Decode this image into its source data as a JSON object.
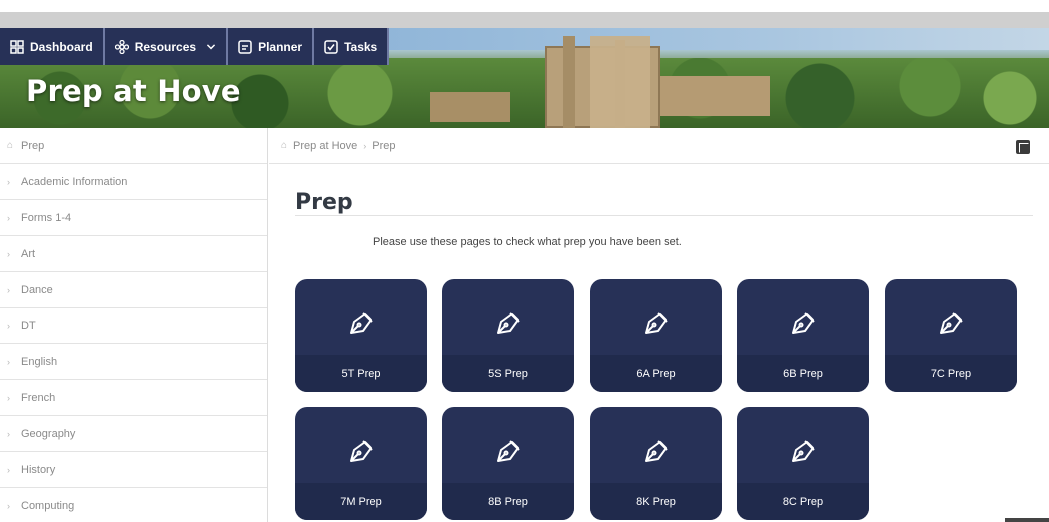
{
  "nav": {
    "items": [
      {
        "label": "Dashboard",
        "icon": "grid-icon"
      },
      {
        "label": "Resources",
        "icon": "cog-flower-icon"
      },
      {
        "label": "Planner",
        "icon": "planner-icon"
      },
      {
        "label": "Tasks",
        "icon": "checkbox-icon"
      }
    ]
  },
  "site": {
    "title": "Prep at Hove"
  },
  "sidebar": {
    "items": [
      {
        "label": "Prep"
      },
      {
        "label": "Academic Information"
      },
      {
        "label": "Forms 1-4"
      },
      {
        "label": "Art"
      },
      {
        "label": "Dance"
      },
      {
        "label": "DT"
      },
      {
        "label": "English"
      },
      {
        "label": "French"
      },
      {
        "label": "Geography"
      },
      {
        "label": "History"
      },
      {
        "label": "Computing"
      }
    ]
  },
  "breadcrumb": {
    "items": [
      "Prep at Hove",
      "Prep"
    ]
  },
  "page": {
    "title": "Prep",
    "intro": "Please use these pages to check what prep you have been set."
  },
  "tiles": [
    {
      "label": "5T Prep"
    },
    {
      "label": "5S Prep"
    },
    {
      "label": "6A Prep"
    },
    {
      "label": "6B Prep"
    },
    {
      "label": "7C Prep"
    },
    {
      "label": "7M Prep"
    },
    {
      "label": "8B Prep"
    },
    {
      "label": "8K Prep"
    },
    {
      "label": "8C Prep"
    }
  ],
  "colors": {
    "navy": "#273157",
    "tile_label_bg": "#202a4c"
  }
}
